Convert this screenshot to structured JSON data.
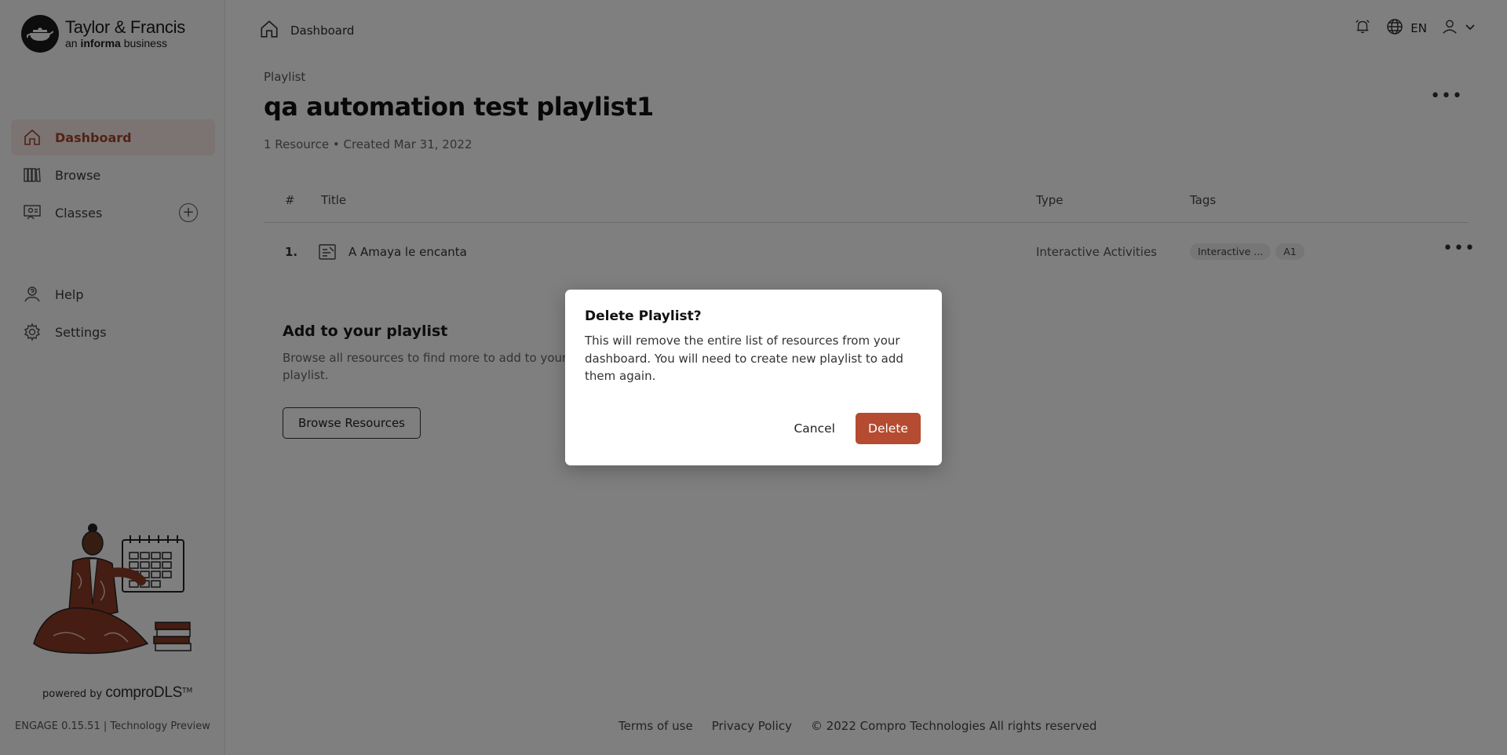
{
  "brand": {
    "name": "Taylor & Francis",
    "sub_prefix": "an",
    "sub_bold": "informa",
    "sub_suffix": "business"
  },
  "sidebar": {
    "items": [
      {
        "label": "Dashboard",
        "icon": "home-icon",
        "active": true
      },
      {
        "label": "Browse",
        "icon": "library-icon"
      },
      {
        "label": "Classes",
        "icon": "classroom-icon",
        "action": "+"
      }
    ],
    "items2": [
      {
        "label": "Help",
        "icon": "help-icon"
      },
      {
        "label": "Settings",
        "icon": "gear-icon"
      }
    ],
    "powered_prefix": "powered by",
    "powered_brand": "comproDLS",
    "powered_tm": "TM",
    "version": "ENGAGE 0.15.51 | Technology Preview"
  },
  "topbar": {
    "breadcrumb": "Dashboard",
    "language": "EN"
  },
  "page": {
    "label": "Playlist",
    "title": "qa automation test playlist1",
    "meta": "1 Resource • Created Mar 31, 2022"
  },
  "table": {
    "headers": {
      "num": "#",
      "title": "Title",
      "type": "Type",
      "tags": "Tags"
    },
    "rows": [
      {
        "num": "1.",
        "title": "A Amaya le encanta",
        "type": "Interactive Activities",
        "tags": [
          "Interactive ...",
          "A1"
        ]
      }
    ]
  },
  "add_playlist": {
    "heading": "Add to your playlist",
    "text": "Browse all resources to find more to add to your playlist.",
    "button": "Browse Resources"
  },
  "footer": {
    "terms": "Terms of use",
    "privacy": "Privacy Policy",
    "copyright": "© 2022 Compro Technologies All rights reserved"
  },
  "modal": {
    "title": "Delete Playlist?",
    "body": "This will remove the entire list of resources from your dashboard. You will need to create new playlist to add them again.",
    "cancel": "Cancel",
    "delete": "Delete"
  },
  "colors": {
    "accent": "#b54b30",
    "active_bg": "#f7e9e4",
    "overlay": "rgba(0,0,0,0.5)"
  }
}
